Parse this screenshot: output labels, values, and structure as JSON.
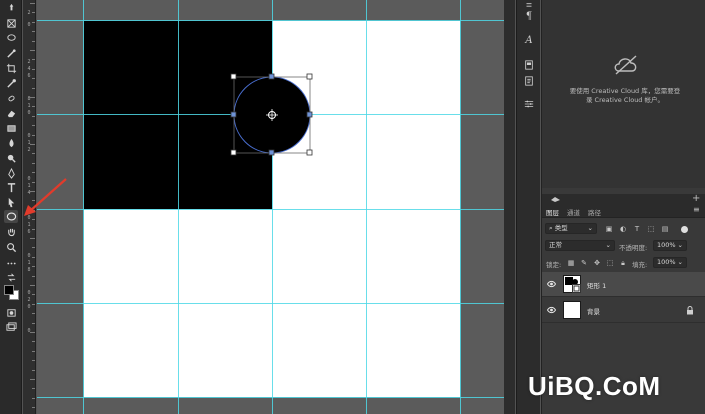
{
  "ruler_numbers": [
    "2",
    "0",
    "2",
    "4",
    "6",
    "8",
    "1",
    "0",
    "0",
    "1",
    "2",
    "0",
    "1",
    "4",
    "0",
    "1",
    "6",
    "0",
    "1",
    "8",
    "0",
    "2",
    "0",
    "0"
  ],
  "canvas": {
    "guide_color": "#4fd8e6",
    "foreground_color": "#000000",
    "background_color": "#ffffff"
  },
  "tools": [
    "move-tool",
    "artboard-tool",
    "lasso-tool",
    "quick-select-tool",
    "crop-tool",
    "eyedropper-tool",
    "healing-brush-tool",
    "brush-tool",
    "clone-stamp-tool",
    "history-brush-tool",
    "eraser-tool",
    "gradient-tool",
    "blur-tool",
    "dodge-tool",
    "pen-tool",
    "type-tool",
    "path-select-tool",
    "ellipse-tool",
    "hand-tool",
    "zoom-tool",
    "more-tools",
    "edit-toolbar"
  ],
  "dock": {
    "char_icon": "A",
    "para_icon": "¶"
  },
  "cc_library": {
    "message_line1": "要使用 Creative Cloud 库，您需要登",
    "message_line2": "录 Creative Cloud 帐户。"
  },
  "layers_panel": {
    "tabs": [
      "图层",
      "通道",
      "路径"
    ],
    "filter_value": "类型",
    "blend_mode": "正常",
    "opacity_label": "不透明度:",
    "opacity_value": "100%",
    "lock_label": "锁定:",
    "fill_label": "填充:",
    "fill_value": "100%",
    "layers": [
      {
        "name": "矩形 1",
        "selected": true
      },
      {
        "name": "背景",
        "selected": false
      }
    ]
  },
  "watermark": "UiBQ.CoM"
}
